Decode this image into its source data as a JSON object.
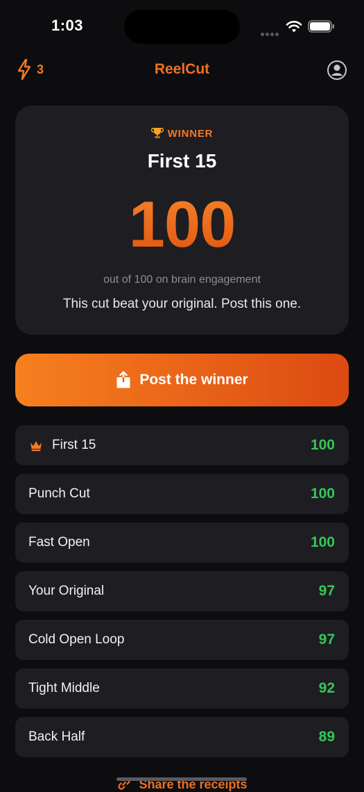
{
  "status_bar": {
    "time": "1:03"
  },
  "nav": {
    "title": "ReelCut",
    "credits": "3",
    "bolt_icon": "bolt-icon",
    "profile_icon": "person-circle-icon"
  },
  "winner": {
    "badge": "WINNER",
    "name": "First 15",
    "score": "100",
    "caption": "out of 100 on brain engagement",
    "message": "This cut beat your original. Post this one."
  },
  "post_button": {
    "label": "Post the winner",
    "icon": "share-icon"
  },
  "results": [
    {
      "name": "First 15",
      "score": "100",
      "crown": true
    },
    {
      "name": "Punch Cut",
      "score": "100",
      "crown": false
    },
    {
      "name": "Fast Open",
      "score": "100",
      "crown": false
    },
    {
      "name": "Your Original",
      "score": "97",
      "crown": false
    },
    {
      "name": "Cold Open Loop",
      "score": "97",
      "crown": false
    },
    {
      "name": "Tight Middle",
      "score": "92",
      "crown": false
    },
    {
      "name": "Back Half",
      "score": "89",
      "crown": false
    }
  ],
  "footer": {
    "share_receipts": "Share the receipts"
  },
  "colors": {
    "accent": "#f0701f",
    "score_green": "#34c759",
    "card_bg": "#1d1d22",
    "page_bg": "#0d0d10"
  }
}
